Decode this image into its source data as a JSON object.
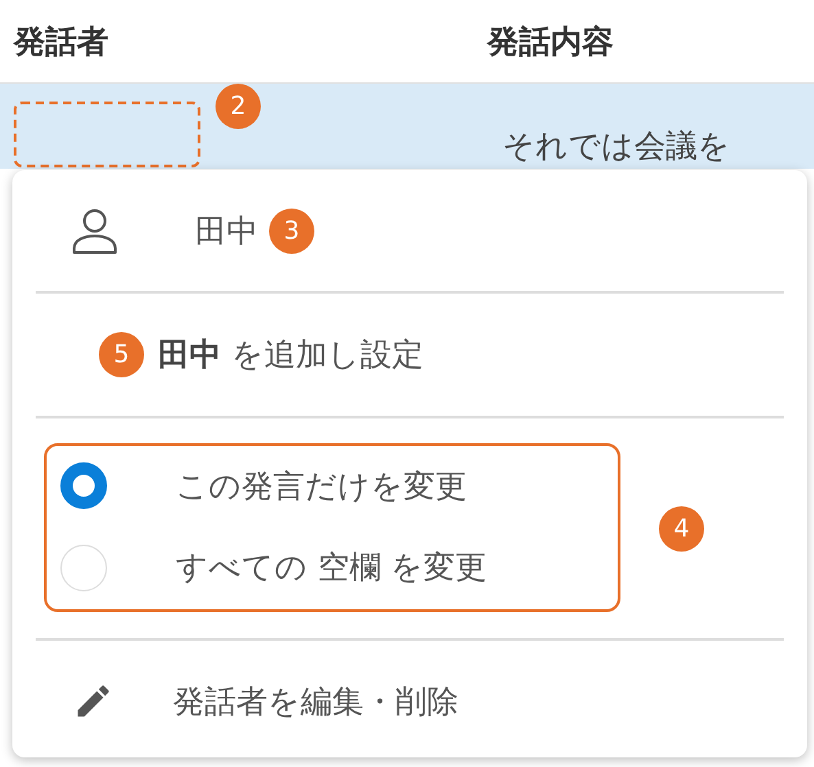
{
  "table": {
    "columns": [
      "発話者",
      "発話内容"
    ],
    "rows": [
      {
        "speaker": "",
        "speaker_badge": "2",
        "text": "それでは会議を",
        "selected": true
      }
    ]
  },
  "menu": {
    "speaker": {
      "name": "田中",
      "badge": "3"
    },
    "add": {
      "label": "**田中** を追加し設定",
      "badge": "5"
    },
    "scope": {
      "badge": "4",
      "options": [
        {
          "label": "この発言だけを変更",
          "selected": true
        },
        {
          "label": "すべての 空欄 を変更",
          "selected": false
        }
      ]
    },
    "edit": {
      "label": "発話者を編集・削除"
    }
  }
}
